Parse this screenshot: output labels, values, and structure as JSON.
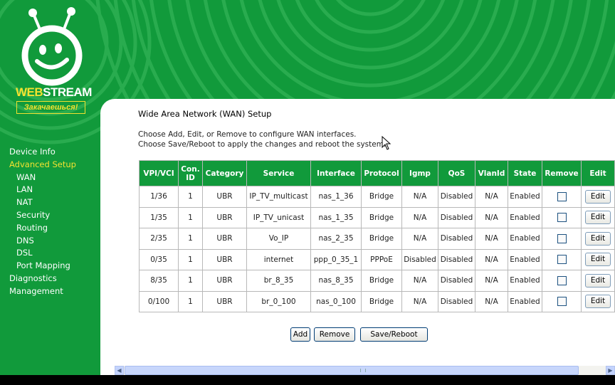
{
  "brand": {
    "web": "WEB",
    "stream": "STREAM",
    "slogan": "Закачаешься!"
  },
  "nav": {
    "device_info": "Device Info",
    "advanced_setup": "Advanced Setup",
    "wan": "WAN",
    "lan": "LAN",
    "nat": "NAT",
    "security": "Security",
    "routing": "Routing",
    "dns": "DNS",
    "dsl": "DSL",
    "port_mapping": "Port Mapping",
    "diagnostics": "Diagnostics",
    "management": "Management"
  },
  "page": {
    "title": "Wide Area Network (WAN) Setup",
    "desc_line1": "Choose Add, Edit, or Remove to configure WAN interfaces.",
    "desc_line2": "Choose Save/Reboot to apply the changes and reboot the system."
  },
  "table": {
    "headers": {
      "vpi_vci": "VPI/VCI",
      "con_id_1": "Con.",
      "con_id_2": "ID",
      "category": "Category",
      "service": "Service",
      "interface": "Interface",
      "protocol": "Protocol",
      "igmp": "Igmp",
      "qos": "QoS",
      "vlanid": "VlanId",
      "state": "State",
      "remove": "Remove",
      "edit": "Edit"
    },
    "edit_label": "Edit",
    "rows": [
      {
        "vpi_vci": "1/36",
        "con_id": "1",
        "category": "UBR",
        "service": "IP_TV_multicast",
        "interface": "nas_1_36",
        "protocol": "Bridge",
        "igmp": "N/A",
        "qos": "Disabled",
        "vlanid": "N/A",
        "state": "Enabled"
      },
      {
        "vpi_vci": "1/35",
        "con_id": "1",
        "category": "UBR",
        "service": "IP_TV_unicast",
        "interface": "nas_1_35",
        "protocol": "Bridge",
        "igmp": "N/A",
        "qos": "Disabled",
        "vlanid": "N/A",
        "state": "Enabled"
      },
      {
        "vpi_vci": "2/35",
        "con_id": "1",
        "category": "UBR",
        "service": "Vo_IP",
        "interface": "nas_2_35",
        "protocol": "Bridge",
        "igmp": "N/A",
        "qos": "Disabled",
        "vlanid": "N/A",
        "state": "Enabled"
      },
      {
        "vpi_vci": "0/35",
        "con_id": "1",
        "category": "UBR",
        "service": "internet",
        "interface": "ppp_0_35_1",
        "protocol": "PPPoE",
        "igmp": "Disabled",
        "qos": "Disabled",
        "vlanid": "N/A",
        "state": "Enabled"
      },
      {
        "vpi_vci": "8/35",
        "con_id": "1",
        "category": "UBR",
        "service": "br_8_35",
        "interface": "nas_8_35",
        "protocol": "Bridge",
        "igmp": "N/A",
        "qos": "Disabled",
        "vlanid": "N/A",
        "state": "Enabled"
      },
      {
        "vpi_vci": "0/100",
        "con_id": "1",
        "category": "UBR",
        "service": "br_0_100",
        "interface": "nas_0_100",
        "protocol": "Bridge",
        "igmp": "N/A",
        "qos": "Disabled",
        "vlanid": "N/A",
        "state": "Enabled"
      }
    ]
  },
  "buttons": {
    "add": "Add",
    "remove": "Remove",
    "save_reboot": "Save/Reboot"
  },
  "colors": {
    "brand_green": "#119a3b",
    "brand_yellow": "#f2e230"
  },
  "icons": [
    "smiley-logo",
    "checkbox",
    "arrow-left-icon",
    "arrow-right-icon",
    "mouse-cursor-icon"
  ]
}
